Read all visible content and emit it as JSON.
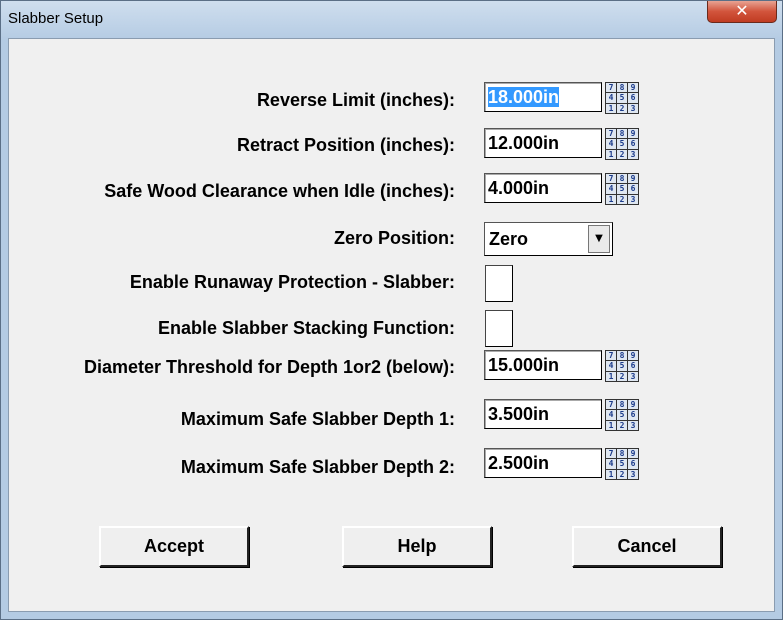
{
  "window": {
    "title": "Slabber Setup",
    "close_glyph": "✕"
  },
  "fields": {
    "reverse_limit": {
      "label": "Reverse Limit (inches):",
      "value": "18.000in"
    },
    "retract_position": {
      "label": "Retract Position (inches):",
      "value": "12.000in"
    },
    "safe_wood_clearance": {
      "label": "Safe Wood Clearance when Idle (inches):",
      "value": "4.000in"
    },
    "zero_position": {
      "label": "Zero Position:",
      "value": "Zero"
    },
    "runaway_protection": {
      "label": "Enable Runaway Protection - Slabber:",
      "checked": false
    },
    "stacking_function": {
      "label": "Enable Slabber Stacking Function:",
      "checked": false
    },
    "diameter_threshold": {
      "label": "Diameter Threshold for Depth 1or2 (below):",
      "value": "15.000in"
    },
    "max_depth_1": {
      "label": "Maximum Safe Slabber Depth 1:",
      "value": "3.500in"
    },
    "max_depth_2": {
      "label": "Maximum Safe Slabber Depth 2:",
      "value": "2.500in"
    }
  },
  "keypad_digits": [
    "7",
    "8",
    "9",
    "4",
    "5",
    "6",
    "1",
    "2",
    "3"
  ],
  "buttons": {
    "accept": "Accept",
    "help": "Help",
    "cancel": "Cancel"
  },
  "icons": {
    "keypad": "numeric-keypad-icon",
    "dropdown": "chevron-down-icon",
    "close": "close-icon"
  }
}
